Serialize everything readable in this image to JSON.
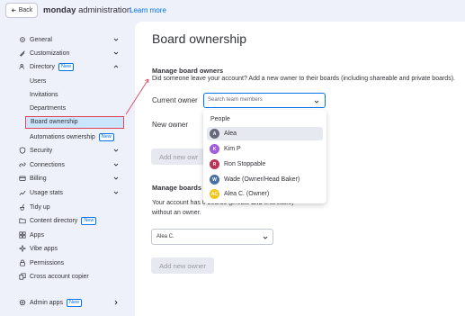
{
  "topbar": {
    "back_label": "Back",
    "brand_bold": "monday",
    "brand_rest": " administration",
    "learn_more": "Learn more"
  },
  "sidebar": {
    "general": "General",
    "customization": "Customization",
    "directory": "Directory",
    "directory_badge": "New",
    "users": "Users",
    "invitations": "Invitations",
    "departments": "Departments",
    "board_ownership": "Board ownership",
    "automations_ownership": "Automations ownership",
    "automations_badge": "New",
    "security": "Security",
    "connections": "Connections",
    "billing": "Billing",
    "usage_stats": "Usage stats",
    "tidy_up": "Tidy up",
    "content_directory": "Content directory",
    "content_badge": "New",
    "apps": "Apps",
    "vibe_apps": "Vibe apps",
    "permissions": "Permissions",
    "cross_account": "Cross account copier",
    "admin_apps": "Admin apps",
    "admin_badge": "New"
  },
  "main": {
    "title": "Board ownership",
    "manage_owners_heading": "Manage board owners",
    "manage_owners_desc": "Did someone leave your account? Add a new owner to their boards (including shareable and private boards).",
    "current_owner_label": "Current owner",
    "search_placeholder": "Search team members",
    "new_owner_label": "New owner",
    "add_new_owner_partial": "Add new owr",
    "manage_boards_heading_partial": "Manage boards w",
    "account_desc_line1_a": "Your account has 0 boards (private ",
    "account_desc_line1_b": "and",
    "account_desc_line1_c": " shareable)",
    "account_desc_line2": "without an owner.",
    "select_value": "Alea C.",
    "add_new_owner": "Add new owner"
  },
  "dropdown": {
    "header": "People",
    "options": [
      {
        "name": "Alea",
        "initials": "A",
        "color": "#676879"
      },
      {
        "name": "Kim P",
        "initials": "K",
        "color": "#a25ddc"
      },
      {
        "name": "Ron Stoppable",
        "initials": "R",
        "color": "#bb3354"
      },
      {
        "name": "Wade",
        "suffix": "(Owner/Head Baker)",
        "initials": "W",
        "color": "#4a6fa5"
      },
      {
        "name": "Alea C.",
        "suffix": "(Owner)",
        "initials": "AC",
        "color": "#f5c518"
      }
    ]
  },
  "colors": {
    "accent": "#0073ea",
    "highlight": "#cce5ff",
    "annotation_red": "#e2445c"
  }
}
